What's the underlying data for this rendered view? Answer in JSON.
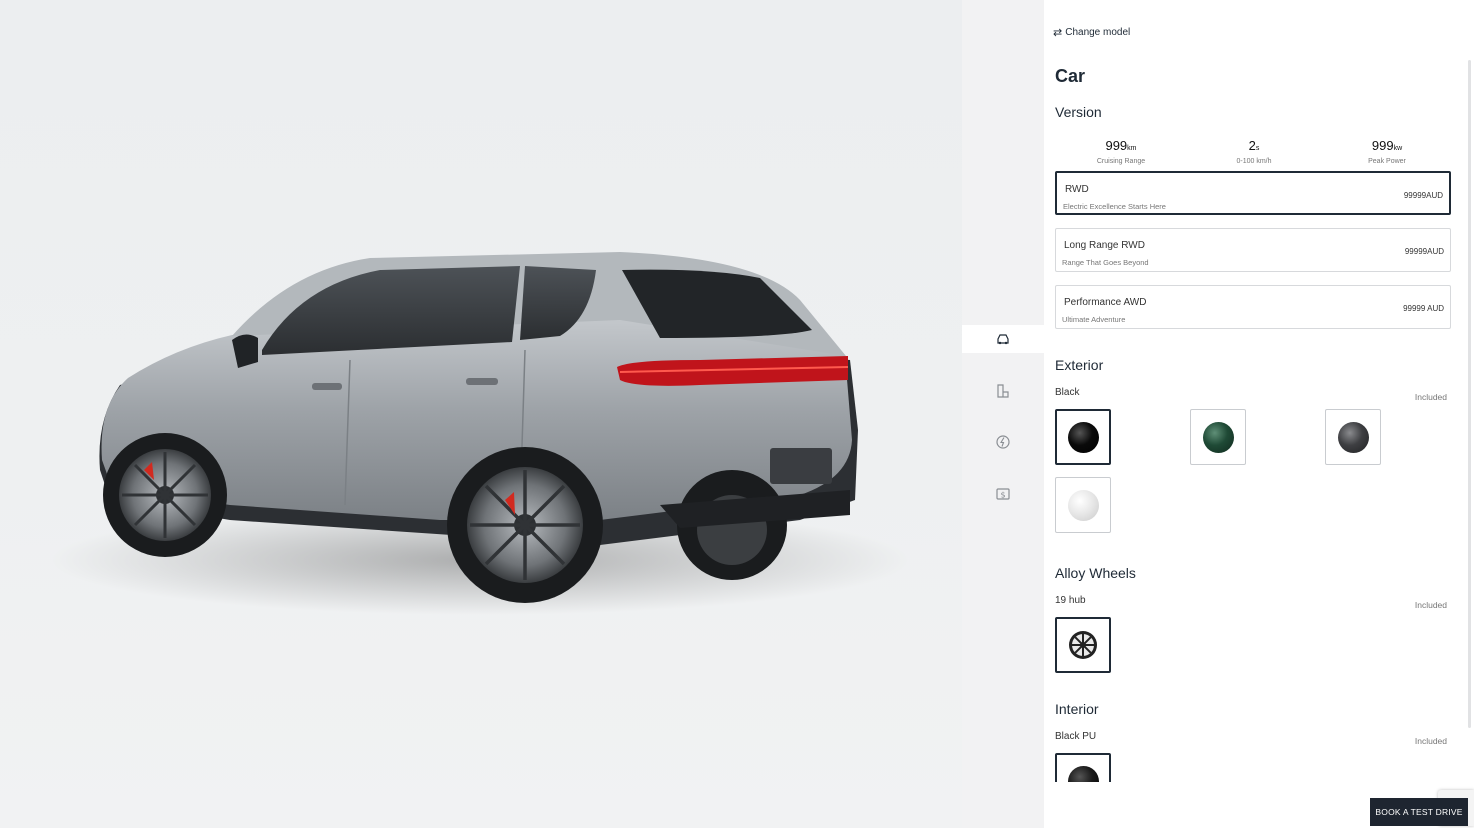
{
  "header": {
    "change_model_icon": "swap-arrows-icon",
    "change_model": "Change model",
    "title": "Car"
  },
  "version": {
    "heading": "Version",
    "specs": [
      {
        "value": "999",
        "unit": "km",
        "label": "Cruising Range"
      },
      {
        "value": "2",
        "unit": "s",
        "label": "0-100 km/h"
      },
      {
        "value": "999",
        "unit": "kw",
        "label": "Peak Power"
      }
    ],
    "options": [
      {
        "name": "RWD",
        "tagline": "Electric Excellence Starts Here",
        "price": "99999AUD",
        "selected": true
      },
      {
        "name": "Long Range RWD",
        "tagline": "Range That Goes Beyond",
        "price": "99999AUD",
        "selected": false
      },
      {
        "name": "Performance AWD",
        "tagline": "Ultimate Adventure",
        "price": "99999 AUD",
        "selected": false
      }
    ]
  },
  "exterior": {
    "heading": "Exterior",
    "selected_name": "Black",
    "included": "Included",
    "colors": [
      {
        "name": "Black",
        "hex": "#0a0a0a",
        "selected": true
      },
      {
        "name": "Green",
        "hex": "#1f4a36",
        "selected": false
      },
      {
        "name": "Grey",
        "hex": "#3e3f42",
        "selected": false
      },
      {
        "name": "White",
        "hex": "#e6e6e6",
        "selected": false
      }
    ]
  },
  "wheels": {
    "heading": "Alloy Wheels",
    "selected_name": "19 hub",
    "included": "Included",
    "icon": "alloy-wheel-icon"
  },
  "interior": {
    "heading": "Interior",
    "selected_name": "Black PU",
    "included": "Included",
    "hex": "#1a1a1a"
  },
  "rail": {
    "icons": [
      "car-body-icon",
      "seat-icon",
      "charging-icon",
      "price-icon"
    ]
  },
  "cta": {
    "book_test_drive": "BOOK A TEST DRIVE"
  },
  "colors": {
    "accent": "#1f2a36",
    "rail_bg": "#f2f2f3",
    "cta_bg": "#1e2530",
    "car_body": "#9ea3a8",
    "tail_light": "#c0141b"
  }
}
